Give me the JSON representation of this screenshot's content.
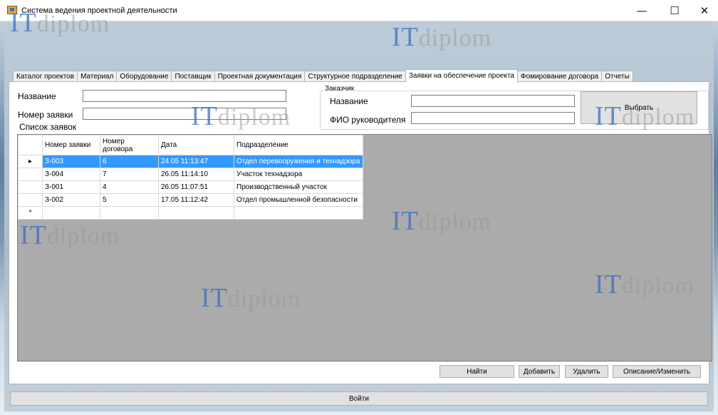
{
  "window": {
    "title": "Система ведения проектной деятельности",
    "controls": {
      "minimize": "—",
      "maximize": "☐",
      "close": "✕"
    }
  },
  "watermark": {
    "it": "IT",
    "diplom": "diplom"
  },
  "tabs": [
    {
      "label": "Каталог проектов",
      "active": false
    },
    {
      "label": "Материал",
      "active": false
    },
    {
      "label": "Оборудование",
      "active": false
    },
    {
      "label": "Поставщик",
      "active": false
    },
    {
      "label": "Проектная документация",
      "active": false
    },
    {
      "label": "Структурное подразделение",
      "active": false
    },
    {
      "label": "Заявки на обеспечение проекта",
      "active": true
    },
    {
      "label": "Фомирование договора",
      "active": false
    },
    {
      "label": "Отчеты",
      "active": false
    }
  ],
  "filter": {
    "name_label": "Название",
    "name_value": "",
    "number_label": "Номер заявки",
    "number_value": "",
    "list_label": "Список заявок"
  },
  "customer": {
    "group_title": "Заказчик",
    "name_label": "Название",
    "name_value": "",
    "manager_label": "ФИО руководителя",
    "manager_value": "",
    "select_button": "Выбрать"
  },
  "grid": {
    "columns": [
      "Номер заявки",
      "Номер договора",
      "Дата",
      "Подразделение"
    ],
    "rows": [
      [
        "З-003",
        "6",
        "24.05 11:13:47",
        "Отдел перевооружения и технадзора"
      ],
      [
        "З-004",
        "7",
        "26.05 11:14:10",
        "Участок технадзора"
      ],
      [
        "З-001",
        "4",
        "26.05 11:07:51",
        "Производственный участок"
      ],
      [
        "З-002",
        "5",
        "17.05 11:12:42",
        "Отдел промышленной безопасности"
      ]
    ],
    "selected_row": 0,
    "current_marker": "▸",
    "new_row_marker": "*"
  },
  "actions": {
    "find": "Найти",
    "add": "Добавить",
    "delete": "Удалить",
    "edit": "Описание/Изменить"
  },
  "footer": {
    "exit": "Войти"
  }
}
